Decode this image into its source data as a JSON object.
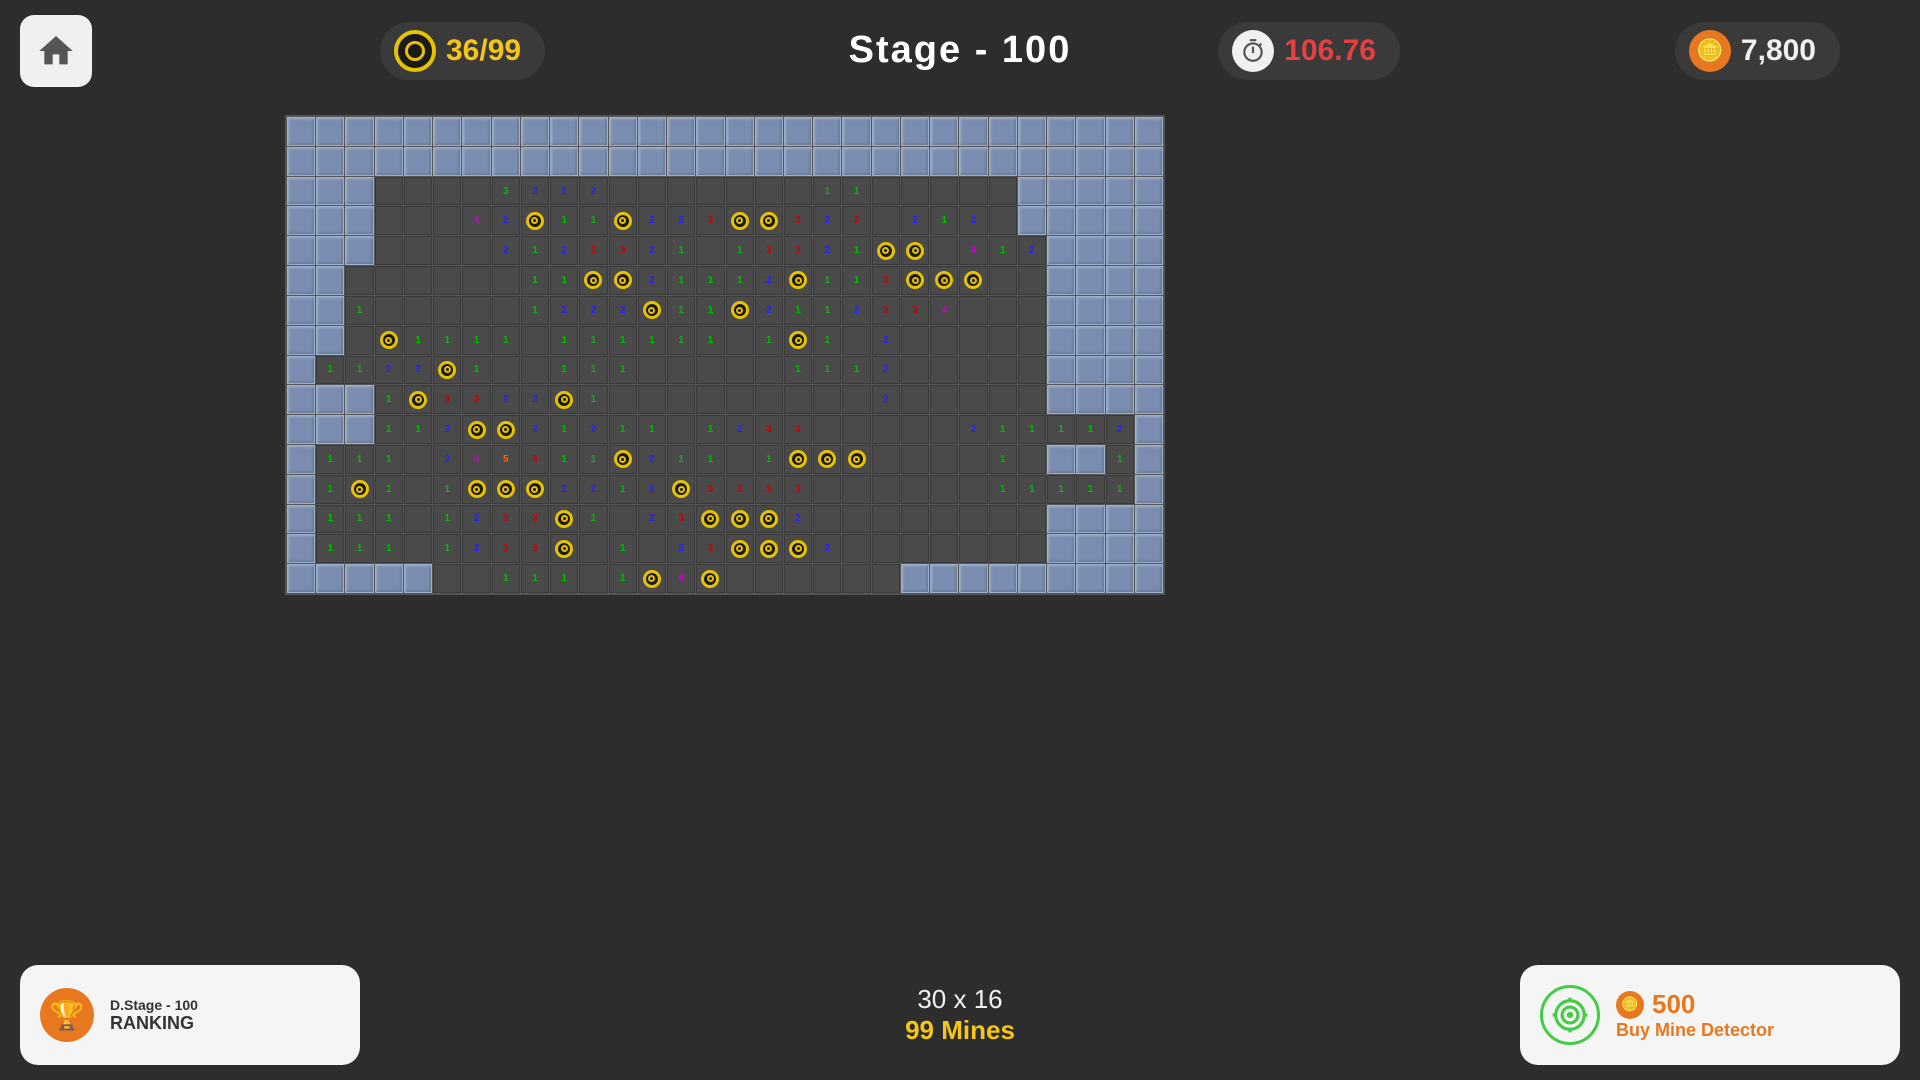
{
  "header": {
    "stage_title": "Stage - 100",
    "lives": "36/99",
    "timer": "106.76",
    "coins": "7,800"
  },
  "footer": {
    "ranking_stage": "D.Stage - 100",
    "ranking_label": "RANKING",
    "grid_size": "30 x 16",
    "mines_count": "99 Mines",
    "detector_cost": "500",
    "detector_label": "Buy Mine Detector"
  },
  "grid": {
    "cols": 30,
    "rows": 16
  }
}
